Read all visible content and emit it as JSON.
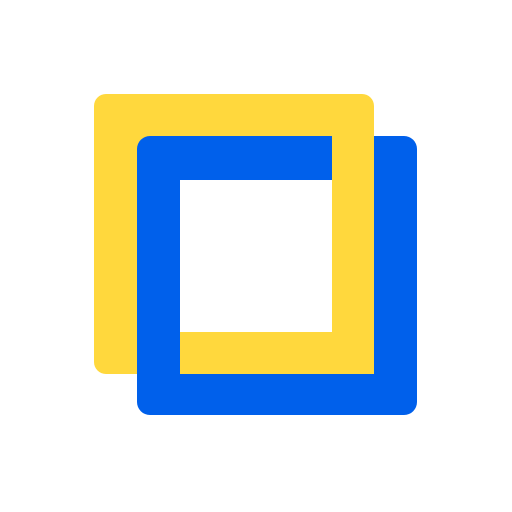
{
  "icon": {
    "name": "overlapping-squares-logo-icon",
    "colors": {
      "yellow": "#FFD83D",
      "blue": "#0060EB",
      "background": "#FFFFFF"
    }
  }
}
